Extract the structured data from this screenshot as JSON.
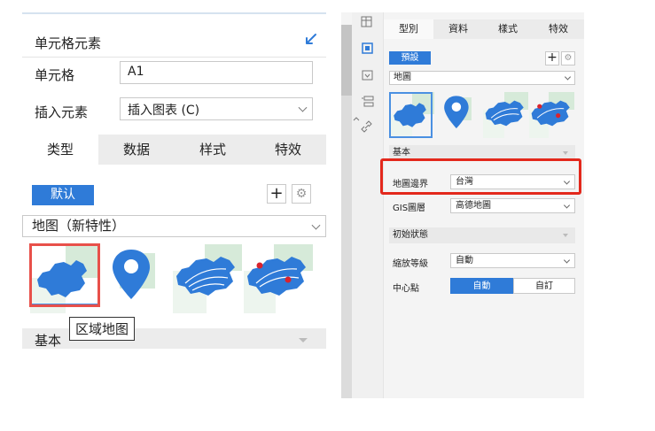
{
  "left_panel": {
    "title": "单元格元素",
    "cell_label": "单元格",
    "cell_value": "A1",
    "insert_label": "插入元素",
    "insert_value": "插入图表 (C)",
    "tabs": [
      "类型",
      "数据",
      "样式",
      "特效"
    ],
    "preset_label": "默认",
    "plus": "+",
    "gear": "⚙",
    "chart_type": "地图（新特性）",
    "tooltip": "区域地图",
    "section_basic": "基本"
  },
  "right_panel": {
    "tabs": [
      "型別",
      "資料",
      "樣式",
      "特效"
    ],
    "preset_label": "預設",
    "plus": "+",
    "gear": "⚙",
    "chart_type": "地圖",
    "section_basic": "基本",
    "map_boundary_label": "地圖邊界",
    "map_boundary_value": "台灣",
    "gis_label": "GIS圖層",
    "gis_value": "高德地圖",
    "section_initial": "初始狀態",
    "zoom_label": "縮放等級",
    "zoom_value": "自動",
    "center_label": "中心點",
    "center_options": [
      "自動",
      "自訂"
    ]
  },
  "colors": {
    "accent_blue": "#2f7bd8",
    "map_blue": "#2f7bd8",
    "highlight_red": "#e3281c",
    "map_marker_red": "#d9232e"
  }
}
